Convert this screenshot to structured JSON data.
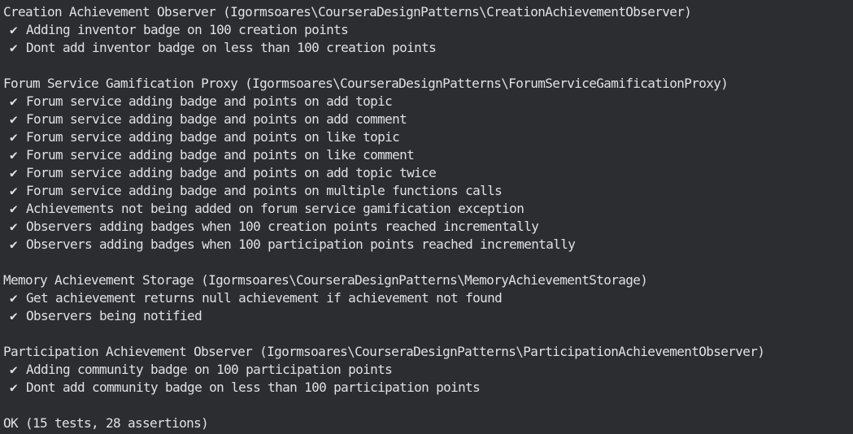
{
  "suites": [
    {
      "header": "Creation Achievement Observer (Igormsoares\\CourseraDesignPatterns\\CreationAchievementObserver)",
      "tests": [
        "Adding inventor badge on 100 creation points",
        "Dont add inventor badge on less than 100 creation points"
      ]
    },
    {
      "header": "Forum Service Gamification Proxy (Igormsoares\\CourseraDesignPatterns\\ForumServiceGamificationProxy)",
      "tests": [
        "Forum service adding badge and points on add topic",
        "Forum service adding badge and points on add comment",
        "Forum service adding badge and points on like topic",
        "Forum service adding badge and points on like comment",
        "Forum service adding badge and points on add topic twice",
        "Forum service adding badge and points on multiple functions calls",
        "Achievements not being added on forum service gamification exception",
        "Observers adding badges when 100 creation points reached incrementally",
        "Observers adding badges when 100 participation points reached incrementally"
      ]
    },
    {
      "header": "Memory Achievement Storage (Igormsoares\\CourseraDesignPatterns\\MemoryAchievementStorage)",
      "tests": [
        "Get achievement returns null achievement if achievement not found",
        "Observers being notified"
      ]
    },
    {
      "header": "Participation Achievement Observer (Igormsoares\\CourseraDesignPatterns\\ParticipationAchievementObserver)",
      "tests": [
        "Adding community badge on 100 participation points",
        "Dont add community badge on less than 100 participation points"
      ]
    }
  ],
  "check_glyph": "✔",
  "summary": "OK (15 tests, 28 assertions)",
  "colors": {
    "background": "#2b2d30",
    "text": "#dfe1e5"
  }
}
